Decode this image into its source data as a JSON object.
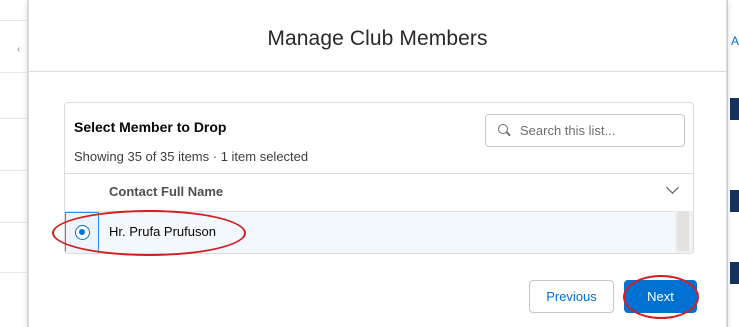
{
  "modal": {
    "title": "Manage Club Members"
  },
  "list": {
    "title": "Select Member to Drop",
    "info": "Showing 35 of 35 items · 1 item selected",
    "search": {
      "placeholder": "Search this list...",
      "value": "",
      "icon": "search-icon"
    },
    "columns": [
      {
        "label": "Contact Full Name",
        "icon": "chevron-down-icon"
      }
    ],
    "rows": [
      {
        "name": "Hr. Prufa Prufuson",
        "selected": true
      }
    ]
  },
  "footer": {
    "previous_label": "Previous",
    "next_label": "Next"
  },
  "background": {
    "right_tab_letter": "A"
  },
  "colors": {
    "brand_blue": "#0070d2",
    "annotation_red": "#d21f1f",
    "selected_row_bg": "#f3f8fd"
  }
}
